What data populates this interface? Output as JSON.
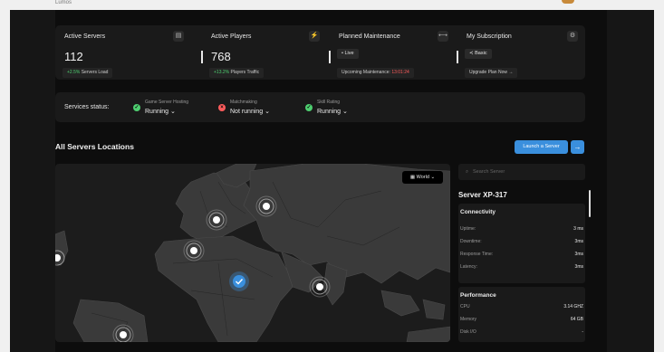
{
  "topbar": {
    "brand_partial": "Lumos"
  },
  "stats": [
    {
      "title": "Active Servers",
      "icon": "server-icon",
      "glyph": "▤",
      "value": "112",
      "sub_highlight": "+2.5%",
      "sub_text": " Servers Load"
    },
    {
      "title": "Active Players",
      "icon": "bolt-icon",
      "glyph": "⚡",
      "value": "768",
      "sub_highlight": "+13.2%",
      "sub_text": " Players Traffic"
    },
    {
      "title": "Planned Maintenance",
      "icon": "wrench-icon",
      "glyph": "⟷",
      "chip": "• Live",
      "sub_text": "Upcoming Maintenance: ",
      "sub_highlight": "13:01:24"
    },
    {
      "title": "My Subscription",
      "icon": "settings-icon",
      "glyph": "⚙",
      "chip": "≺ Basic",
      "sub_text": "Upgrade Plan Now →"
    }
  ],
  "services": {
    "label": "Services status:",
    "items": [
      {
        "name": "Game Server Hosting",
        "status": "Running ⌄",
        "color": "#4ecf70",
        "glyph": "✓"
      },
      {
        "name": "Matchmaking",
        "status": "Not running ⌄",
        "color": "#ff5c5c",
        "glyph": "×"
      },
      {
        "name": "Skill Rating",
        "status": "Running ⌄",
        "color": "#4ecf70",
        "glyph": "✓"
      }
    ]
  },
  "locations": {
    "title": "All Servers Locations",
    "launch_label": "Launch a Server",
    "world_label": "World ⌄"
  },
  "server_panel": {
    "search_placeholder": "Search Server",
    "server_name": "Server XP-317",
    "connectivity": {
      "title": "Connectivity",
      "rows": [
        {
          "label": "Uptime:",
          "value": "3 ms"
        },
        {
          "label": "Downtime:",
          "value": "3ms"
        },
        {
          "label": "Response Time:",
          "value": "3ms"
        },
        {
          "label": "Latency:",
          "value": "3ms"
        }
      ]
    },
    "performance": {
      "title": "Performance",
      "rows": [
        {
          "label": "CPU",
          "value": "3.14 GHZ"
        },
        {
          "label": "Memory",
          "value": "64 GB"
        },
        {
          "label": "Disk I/O",
          "value": "-"
        }
      ]
    }
  },
  "colors": {
    "accent": "#3a8fdd",
    "ok": "#4ecf70",
    "error": "#ff5c5c",
    "surface": "#1a1a1a"
  }
}
